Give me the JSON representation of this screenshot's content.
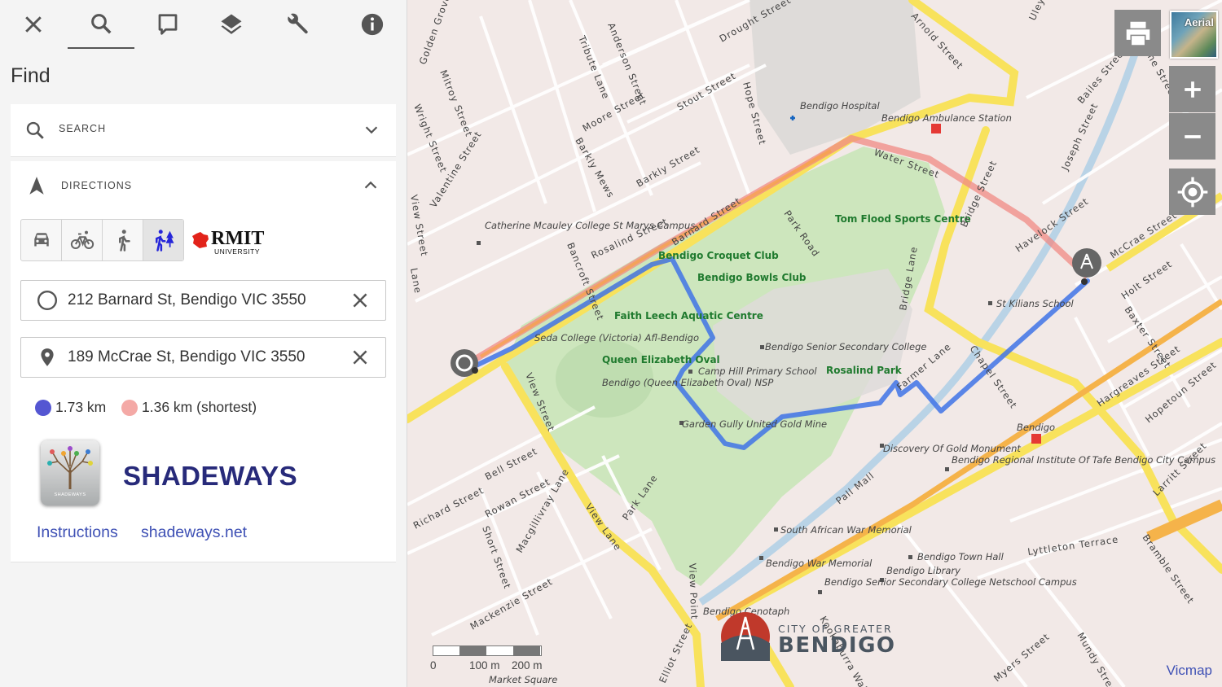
{
  "toolbar": {
    "icons": [
      "close-icon",
      "search-icon",
      "comment-icon",
      "layers-icon",
      "wrench-icon",
      "info-icon"
    ],
    "active": "search-icon"
  },
  "panel": {
    "title": "Find",
    "search": {
      "label": "SEARCH"
    },
    "directions": {
      "label": "DIRECTIONS",
      "modes": [
        "car-icon",
        "bicycle-icon",
        "walking-icon",
        "shade-walking-icon"
      ],
      "selected_mode": "shade-walking-icon",
      "partner_logo": {
        "name": "RMIT",
        "sub": "UNIVERSITY"
      },
      "origin": "212 Barnard St, Bendigo VIC 3550",
      "destination": "189 McCrae St, Bendigo VIC 3550",
      "route_primary": {
        "distance": "1.73 km",
        "color": "#5456d2"
      },
      "route_shortest": {
        "distance": "1.36 km (shortest)",
        "color": "#f4a9a6"
      },
      "brand": {
        "name": "SHADEWAYS",
        "icon_text": "SHADEWAYS"
      },
      "links": {
        "instructions": "Instructions",
        "website": "shadeways.net"
      }
    }
  },
  "map": {
    "controls": {
      "aerial": "Aerial",
      "buttons": [
        "print-icon",
        "zoom-in-icon",
        "zoom-out-icon",
        "locate-icon"
      ]
    },
    "attribution": "Vicmap",
    "scale": {
      "labels": [
        "0",
        "100 m",
        "200 m"
      ]
    },
    "council_logo": {
      "top": "CITY OF GREATER",
      "name": "BENDIGO"
    },
    "route_primary_color": "#3f73e6",
    "route_shortest_color": "#f08a84",
    "places": [
      "Bendigo Hospital",
      "Bendigo Ambulance Station",
      "Tom Flood Sports Centre",
      "Catherine Mcauley College St Marys Campus",
      "Bendigo Croquet Club",
      "Bendigo Bowls Club",
      "Faith Leech Aquatic Centre",
      "Seda College (Victoria) Afl-Bendigo",
      "Queen Elizabeth Oval",
      "Bendigo (Queen Elizabeth Oval) NSP",
      "Camp Hill Primary School",
      "Rosalind Park",
      "Bendigo Senior Secondary College",
      "St Kilians School",
      "Garden Gully United Gold Mine",
      "Discovery Of Gold Monument",
      "Bendigo Regional Institute Of Tafe Bendigo City Campus",
      "Bendigo",
      "South African War Memorial",
      "Bendigo War Memorial",
      "Bendigo Town Hall",
      "Bendigo Library",
      "Bendigo Senior Secondary College Netschool Campus",
      "Bendigo Cenotaph",
      "Market Square"
    ],
    "streets": [
      "Arnold Street",
      "Barnard Street",
      "Water Street",
      "Bridge Street",
      "McCrae Street",
      "Chapel Street",
      "View Street",
      "Pall Mall",
      "Lyttleton Terrace",
      "Myers Street",
      "Park Road",
      "Bridge Lane",
      "Farmer Lane",
      "Rosalind Street",
      "Bancroft Street",
      "Barkly Street",
      "Moore Street",
      "Stout Street",
      "Drought Street",
      "Hope Street",
      "Anderson Street",
      "Tribute Lane",
      "Barkly Mews",
      "Golden Grove",
      "Mitroy Street",
      "Wright Street",
      "Valentine Street",
      "View Street",
      "Lane",
      "Havelock Street",
      "Joseph Street",
      "Bailes Street",
      "Bayne Street",
      "Holt Street",
      "Baxter Street",
      "Hargreaves Street",
      "Hopetoun Street",
      "Larritt Street",
      "Bramble Street",
      "Mundy Street",
      "Kookaburra Walk",
      "Richard Street",
      "Bell Street",
      "Rowan Street",
      "Short Street",
      "Macgillivray Lane",
      "View Lane",
      "Park Lane",
      "Mackenzie Street",
      "View Point",
      "Elliot Street",
      "Uley Street"
    ]
  }
}
